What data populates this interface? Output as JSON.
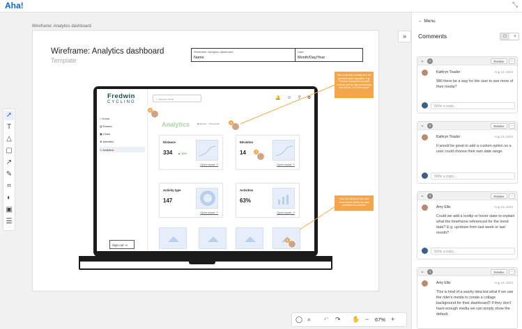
{
  "app": {
    "logo": "Aha!"
  },
  "frame": {
    "label": "Wireframe: Analytics dashboard",
    "title": "Wireframe: Analytics dashboard",
    "subtitle": "Template",
    "table": {
      "name_label": "Wireframe: Analytics dashboard",
      "name_value": "Name",
      "date_label": "Date",
      "date_value": "Month/Day/Year"
    }
  },
  "mock": {
    "brand_line1": "Fredwin",
    "brand_line2": "CYCLING",
    "nav": [
      "Home",
      "Routes",
      "Clubs",
      "Activities",
      "Analytics"
    ],
    "sign_out": "Sign out",
    "search_placeholder": "Search here",
    "page_title": "Analytics",
    "radios": [
      "All time",
      "This month"
    ],
    "cards": [
      {
        "title": "Distance",
        "value": "334",
        "change": "▲ 10%",
        "link": "Open report ↗"
      },
      {
        "title": "Elevation",
        "value": "14",
        "change": "",
        "link": "Open report ↗"
      },
      {
        "title": "Activity type",
        "value": "147",
        "change": "",
        "link": "Open report ↗"
      },
      {
        "title": "Activities",
        "value": "63%",
        "change": "",
        "link": "Open report ↗"
      }
    ],
    "sticky1": "We could add a teddy here for premium plan upgrades. e.g. \"Fredwin Advanced includes metrics just for high performing race teams. Try it free now!\"",
    "sticky2": "This reel will show the four most recent media the user uploaded to activities"
  },
  "canvas_toolbar": {
    "zoom": "67%"
  },
  "panel": {
    "menu": "Menu",
    "title": "Comments",
    "toggle": [
      "▢",
      "≡"
    ],
    "resolve_label": "Resolve",
    "reply_placeholder": "Write a reply...",
    "threads": [
      {
        "num": "1",
        "author": "Kathryn Tirador",
        "date": "Aug 15, 2024",
        "text": "Will there be a way for the user to see more of their media?"
      },
      {
        "num": "2",
        "author": "Kathryn Tirador",
        "date": "Aug 15, 2024",
        "text": "It would be great to add a custom option so a user could choose their own date range."
      },
      {
        "num": "3",
        "author": "Amy Ellis",
        "date": "Aug 15, 2024",
        "text": "Could we add a tooltip or hover state to explain what the timeframe referenced for the trend data? E.g. up/down from last week or last month?"
      },
      {
        "num": "4",
        "author": "Amy Ellis",
        "date": "Aug 15, 2024",
        "text": "This is kind of a wacky idea but what if we use the rider's media to create a collage background for their dashboard? If they don't have enough media we can simply show the default."
      }
    ]
  }
}
